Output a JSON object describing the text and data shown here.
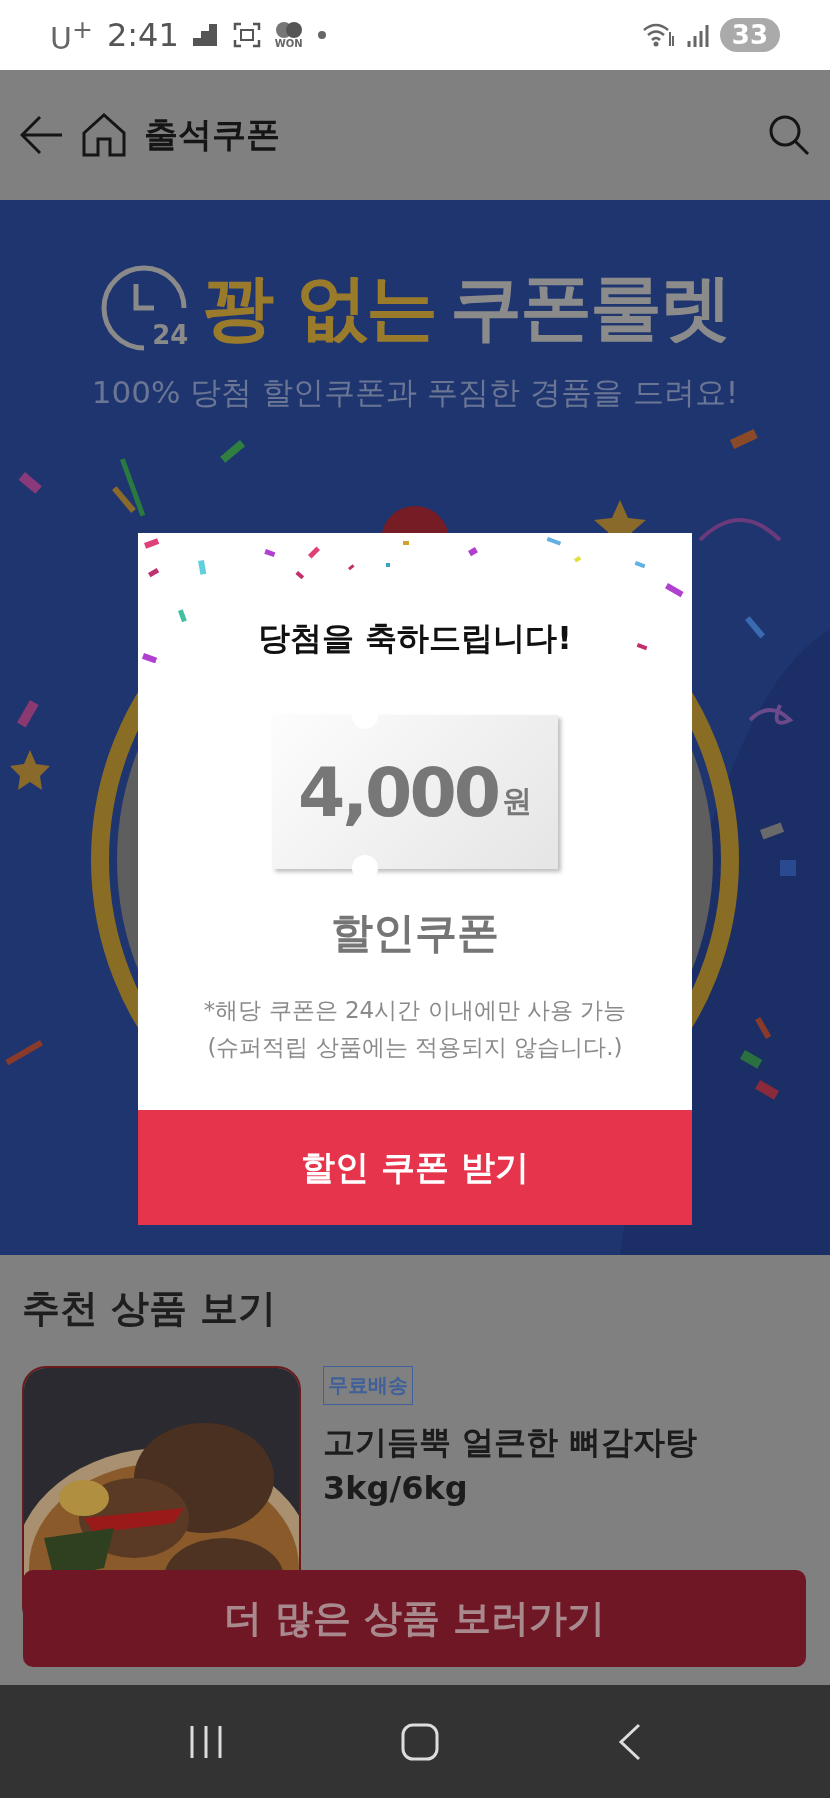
{
  "status_bar": {
    "carrier": "U$^{+}$",
    "time": "2:41",
    "app_label": "WON",
    "battery": "33"
  },
  "header": {
    "title": "출석쿠폰"
  },
  "banner": {
    "clock_label": "24",
    "title_parts": [
      {
        "text": "꽝 없는",
        "kind": "highlight"
      },
      {
        "text": "쿠폰룰렛",
        "kind": "plain"
      }
    ],
    "subtitle": "100% 당첨 할인쿠폰과 푸짐한 경품을 드려요!"
  },
  "modal": {
    "title": "당첨을 축하드립니다!",
    "amount": "4,000",
    "unit": "원",
    "coupon_label": "할인쿠폰",
    "notes": [
      "*해당 쿠폰은 24시간 이내에만 사용 가능",
      "(슈퍼적립 상품에는 적용되지 않습니다.)"
    ],
    "button": "할인 쿠폰 받기"
  },
  "recommend": {
    "heading": "추천 상품 보기",
    "product": {
      "badge": "무료배송",
      "title": "고기듬뿍 얼큰한 뼈감자탕 3kg/6kg"
    }
  },
  "more_button": "더 많은 상품 보러가기"
}
